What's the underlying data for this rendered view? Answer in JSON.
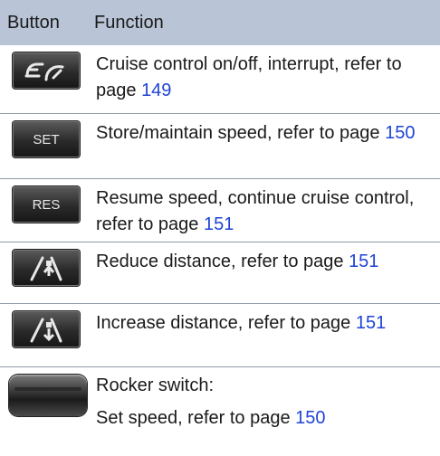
{
  "header": {
    "col1": "Button",
    "col2": "Function"
  },
  "rows": [
    {
      "button": "",
      "icon": "cruise-control-icon",
      "text": "Cruise control on/off, interrupt, refer to page ",
      "page": "149"
    },
    {
      "button": "SET",
      "icon": "",
      "text": "Store/maintain speed, refer to page ",
      "page": "150"
    },
    {
      "button": "RES",
      "icon": "",
      "text": "Resume speed, continue cruise control, refer to page ",
      "page": "151"
    },
    {
      "button": "",
      "icon": "distance-reduce-icon",
      "text": "Reduce distance, refer to page ",
      "page": "151"
    },
    {
      "button": "",
      "icon": "distance-increase-icon",
      "text": "Increase distance, refer to page ",
      "page": "151"
    },
    {
      "button": "",
      "icon": "rocker-switch-icon",
      "text_line1": "Rocker switch:",
      "text": "Set speed, refer to page ",
      "page": "150"
    }
  ]
}
